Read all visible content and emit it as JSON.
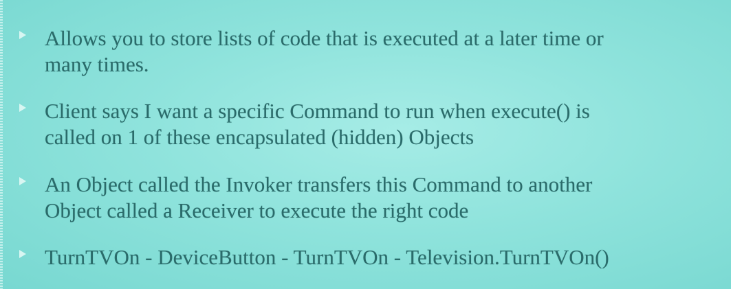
{
  "slide": {
    "bullets": [
      {
        "text": "Allows you to store lists of code that is executed at a later time or\nmany times."
      },
      {
        "text": "Client says I want a specific Command to run when execute() is\ncalled on 1 of these encapsulated (hidden) Objects"
      },
      {
        "text": "An Object called the Invoker transfers this Command to another\nObject called a Receiver to execute the right code"
      },
      {
        "text": "TurnTVOn - DeviceButton - TurnTVOn - Television.TurnTVOn()"
      }
    ]
  },
  "colors": {
    "background": "#8fe3dc",
    "text": "#2a6b6a",
    "bullet_marker": "#d8f6f2"
  },
  "icons": {
    "bullet_marker": "triangle-right-icon"
  }
}
